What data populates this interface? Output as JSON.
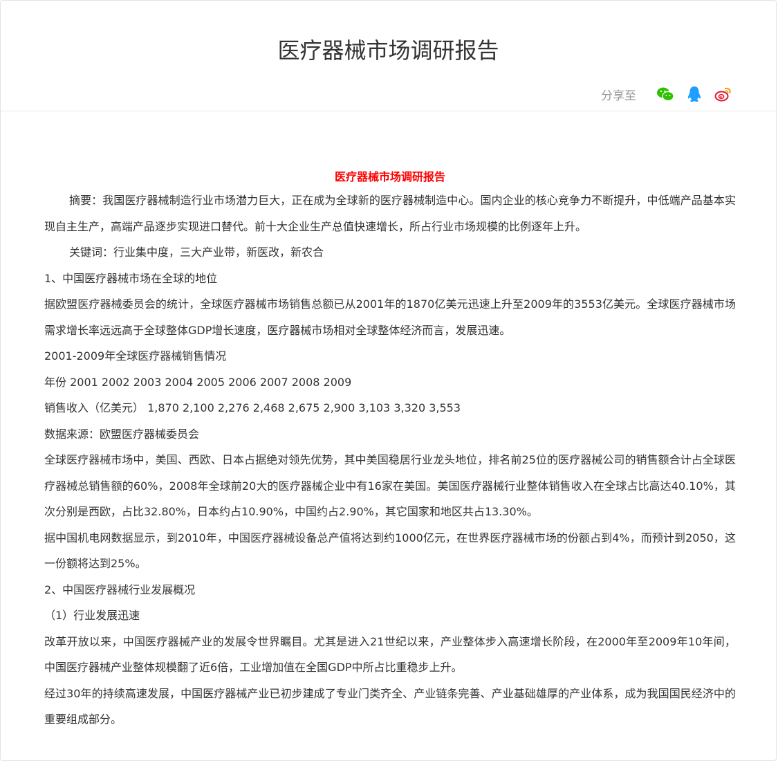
{
  "page": {
    "title": "医疗器械市场调研报告"
  },
  "share": {
    "label": "分享至",
    "icons": [
      {
        "name": "wechat-icon",
        "color": "#2dc100"
      },
      {
        "name": "qq-icon",
        "color": "#1e9eff"
      },
      {
        "name": "weibo-icon",
        "color": "#e6162d"
      }
    ]
  },
  "article": {
    "heading": "医疗器械市场调研报告",
    "paragraphs": [
      "摘要：我国医疗器械制造行业市场潜力巨大，正在成为全球新的医疗器械制造中心。国内企业的核心竞争力不断提升，中低端产品基本实现自主生产，高端产品逐步实现进口替代。前十大企业生产总值快速增长，所占行业市场规模的比例逐年上升。",
      "关键词：行业集中度，三大产业带，新医改，新农合",
      "1、中国医疗器械市场在全球的地位",
      "据欧盟医疗器械委员会的统计，全球医疗器械市场销售总额已从2001年的1870亿美元迅速上升至2009年的3553亿美元。全球医疗器械市场需求增长率远远高于全球整体GDP增长速度，医疗器械市场相对全球整体经济而言，发展迅速。",
      "2001-2009年全球医疗器械销售情况",
      "年份 2001 2002 2003 2004 2005 2006 2007 2008 2009",
      "销售收入（亿美元） 1,870 2,100 2,276 2,468 2,675 2,900 3,103 3,320 3,553",
      "数据来源：欧盟医疗器械委员会",
      "全球医疗器械市场中，美国、西欧、日本占据绝对领先优势，其中美国稳居行业龙头地位，排名前25位的医疗器械公司的销售额合计占全球医疗器械总销售额的60%，2008年全球前20大的医疗器械企业中有16家在美国。美国医疗器械行业整体销售收入在全球占比高达40.10%，其次分别是西欧，占比32.80%，日本约占10.90%，中国约占2.90%，其它国家和地区共占13.30%。",
      "据中国机电网数据显示，到2010年，中国医疗器械设备总产值将达到约1000亿元，在世界医疗器械市场的份额占到4%，而预计到2050，这一份额将达到25%。",
      "2、中国医疗器械行业发展概况",
      "（1）行业发展迅速",
      "改革开放以来，中国医疗器械产业的发展令世界瞩目。尤其是进入21世纪以来，产业整体步入高速增长阶段，在2000年至2009年10年间，中国医疗器械产业整体规模翻了近6倍，工业增加值在全国GDP中所占比重稳步上升。",
      "经过30年的持续高速发展，中国医疗器械产业已初步建成了专业门类齐全、产业链条完善、产业基础雄厚的产业体系，成为我国国民经济中的重要组成部分。"
    ]
  }
}
